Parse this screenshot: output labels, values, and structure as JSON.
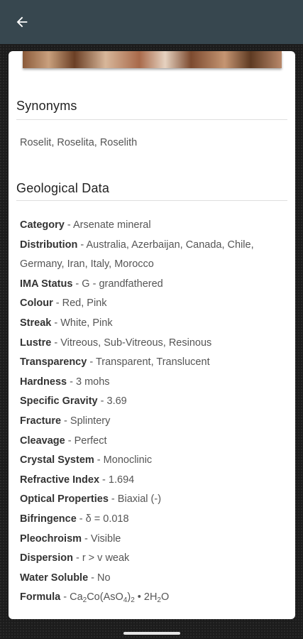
{
  "appbar": {
    "back_icon": "arrow-left-icon",
    "color": "#37474f"
  },
  "synonyms": {
    "title": "Synonyms",
    "text": "Roselit, Roselita, Roselith"
  },
  "geological": {
    "title": "Geological Data",
    "properties": [
      {
        "label": "Category",
        "value": "Arsenate mineral"
      },
      {
        "label": "Distribution",
        "value": "Australia, Azerbaijan, Canada, Chile, Germany, Iran, Italy, Morocco"
      },
      {
        "label": "IMA Status",
        "value": "G - grandfathered"
      },
      {
        "label": "Colour",
        "value": "Red, Pink"
      },
      {
        "label": "Streak",
        "value": "White, Pink"
      },
      {
        "label": "Lustre",
        "value": "Vitreous, Sub-Vitreous, Resinous"
      },
      {
        "label": "Transparency",
        "value": "Transparent, Translucent"
      },
      {
        "label": "Hardness",
        "value": "3 mohs"
      },
      {
        "label": "Specific Gravity",
        "value": "3.69"
      },
      {
        "label": "Fracture",
        "value": "Splintery"
      },
      {
        "label": "Cleavage",
        "value": "Perfect"
      },
      {
        "label": "Crystal System",
        "value": "Monoclinic"
      },
      {
        "label": "Refractive Index",
        "value": "1.694"
      },
      {
        "label": "Optical Properties",
        "value": "Biaxial (-)"
      },
      {
        "label": "Bifringence",
        "value": "δ = 0.018"
      },
      {
        "label": "Pleochroism",
        "value": "Visible"
      },
      {
        "label": "Dispersion",
        "value": "r > v weak"
      },
      {
        "label": "Water Soluble",
        "value": "No"
      }
    ],
    "formula": {
      "label": "Formula",
      "parts": [
        "Ca",
        "2",
        "Co(AsO",
        "4",
        ")",
        "2",
        " • 2H",
        "2",
        "O"
      ]
    }
  },
  "separator": " - "
}
